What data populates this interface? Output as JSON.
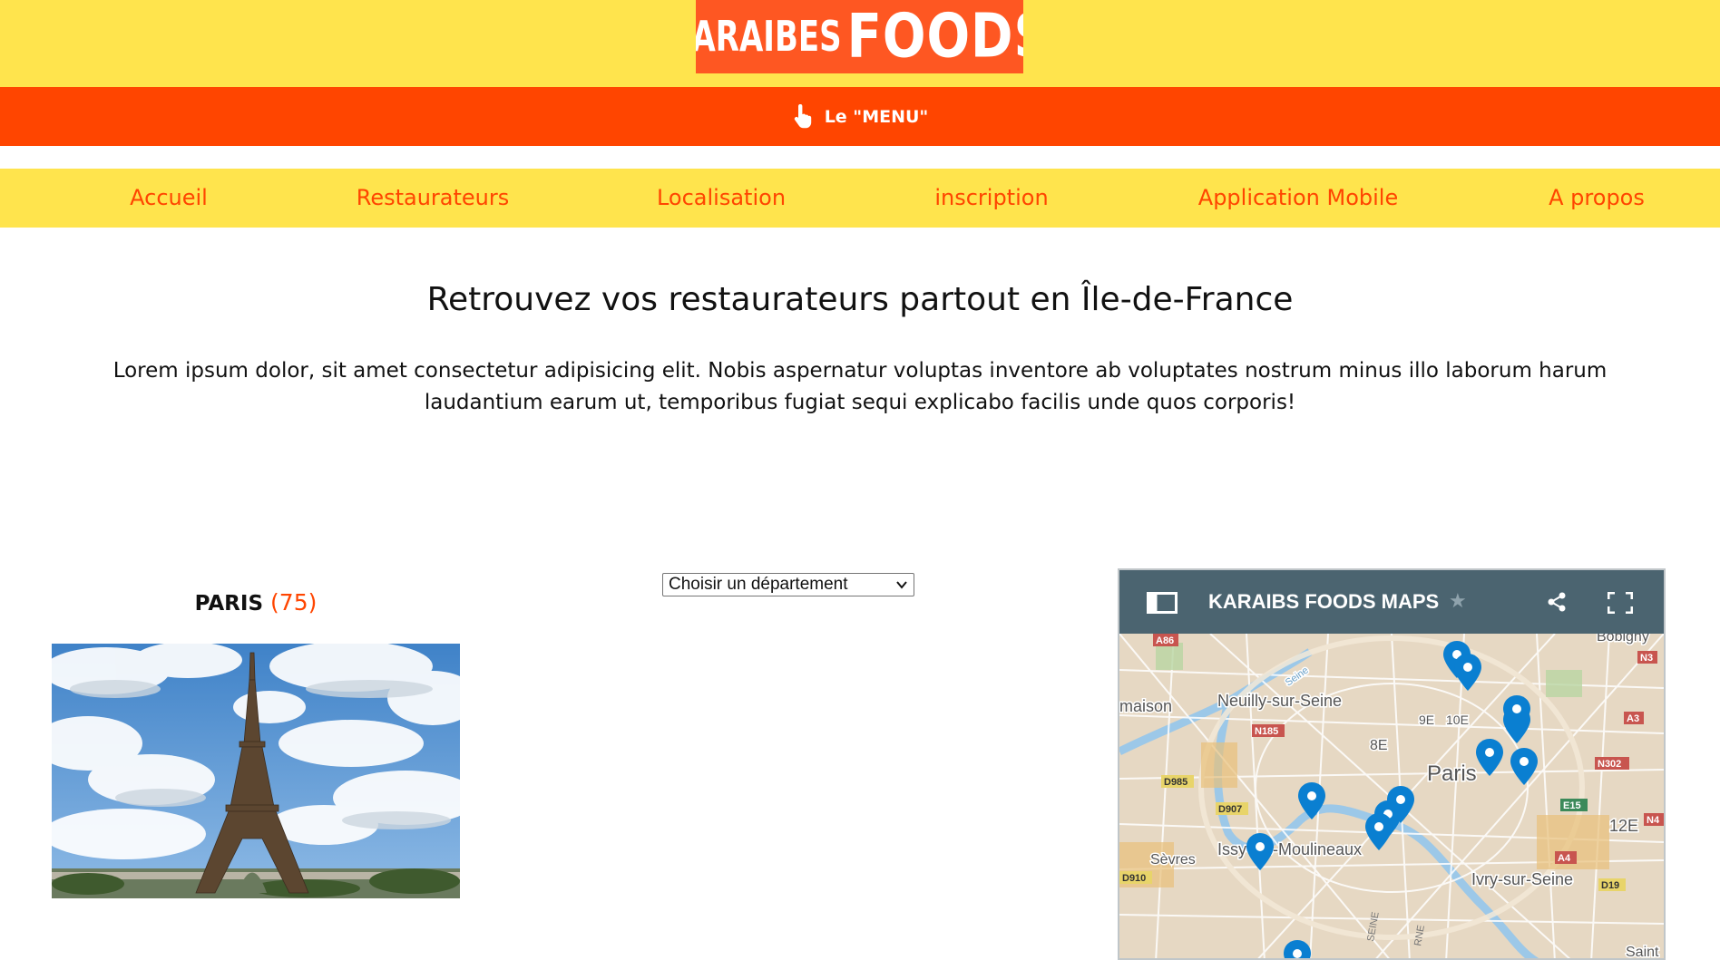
{
  "brand": {
    "logo_left": "KARAIBES",
    "logo_right": "FOODS",
    "primary": "#ff4500",
    "yellow": "#ffe44d",
    "logo_bg": "#fe5722"
  },
  "menu_bar": {
    "label": "Le \"MENU\"",
    "icon": "pointing-hand-icon"
  },
  "nav": [
    "Accueil",
    "Restaurateurs",
    "Localisation",
    "inscription",
    "Application Mobile",
    "A propos"
  ],
  "hero": {
    "title": "Retrouvez vos restaurateurs partout en Île-de-France",
    "text": "Lorem ipsum dolor, sit amet consectetur adipisicing elit. Nobis aspernatur voluptas inventore ab voluptates nostrum minus illo laborum harum laudantium earum ut, temporibus fugiat sequi explicabo facilis unde quos corporis!"
  },
  "department": {
    "name": "PARIS",
    "code": "(75)"
  },
  "department_select": {
    "selected": "Choisir un département"
  },
  "map": {
    "title": "KARAIBS FOODS MAPS",
    "icons": [
      "sidebar-toggle-icon",
      "star-icon",
      "share-icon",
      "fullscreen-icon"
    ],
    "labels": {
      "places": [
        "Neuilly-sur-Seine",
        "Paris",
        "Issy-les-Moulineaux",
        "Ivry-sur-Seine",
        "maison",
        "Sèvres",
        "Bobigny",
        "Saint",
        "Seine"
      ],
      "arrondissements": [
        "9E",
        "10E",
        "8E",
        "12E"
      ],
      "roads": [
        "A86",
        "N3",
        "N185",
        "A3",
        "N302",
        "D985",
        "D907",
        "E15",
        "N4",
        "A4",
        "D910",
        "D19",
        "SEINE",
        "RNE"
      ]
    }
  }
}
